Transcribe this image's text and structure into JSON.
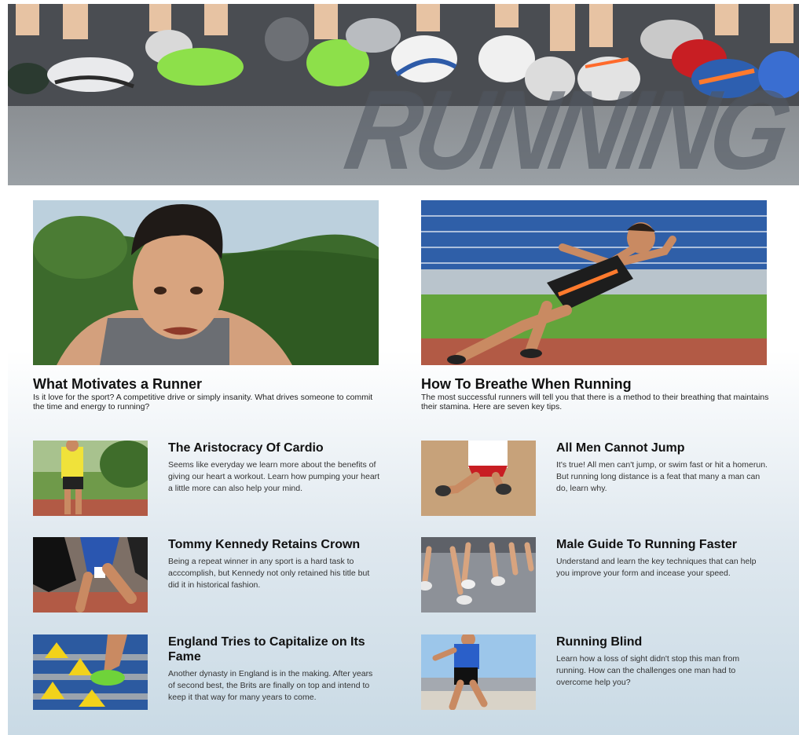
{
  "hero": {
    "title": "RUNNING"
  },
  "features": [
    {
      "title": "What Motivates a Runner",
      "description": "Is it love for the sport? A competitive drive or simply insanity. What drives someone to commit the time and energy to running?"
    },
    {
      "title": "How To Breathe When Running",
      "description": "The most successful runners will tell you that there is a method to their breathing that maintains their stamina. Here are seven key tips."
    }
  ],
  "articles": [
    {
      "title": "The Aristocracy Of Cardio",
      "description": "Seems like everyday we learn more about the benefits of giving our heart a workout. Learn how pumping your heart a little more can also help your mind."
    },
    {
      "title": "All Men Cannot Jump",
      "description": "It's true! All men can't jump, or swim fast or hit a homerun. But running long distance is a feat that many a man can do, learn why."
    },
    {
      "title": "Tommy Kennedy Retains Crown",
      "description": "Being a repeat winner in any sport is a hard task to acccomplish, but Kennedy not only retained his title but did it in historical fashion."
    },
    {
      "title": "Male Guide To Running Faster",
      "description": "Understand and learn the key techniques that can help you improve your form and incease your speed."
    },
    {
      "title": "England Tries to Capitalize on Its Fame",
      "description": "Another dynasty in England is in the making. After years of second best, the Brits are finally on top and intend to keep it that way for many years to come."
    },
    {
      "title": "Running Blind",
      "description": "Learn how a loss of sight didn't stop this man from running. How can the challenges one man had to overcome help you?"
    }
  ],
  "colors": {
    "track": "#b25a45",
    "grass": "#5f9a3a",
    "sky": "#cfe1ee",
    "stadium_blue": "#2f5fa8"
  }
}
